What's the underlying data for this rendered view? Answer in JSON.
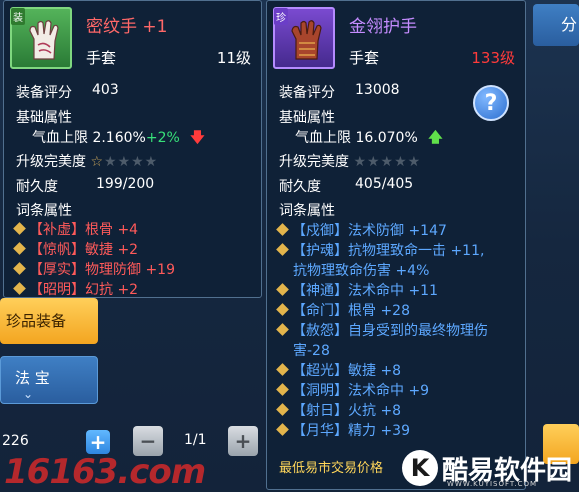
{
  "background": {
    "tab_top_right": "分",
    "tab_treasure": "珍品装备",
    "tab_fabao": "法 宝",
    "item_count": "226",
    "page": "1/1",
    "watermark_left": "16163.com",
    "watermark_right": "酷易软件园",
    "watermark_right_sub": "WWW.KUYISOFT.COM",
    "watermark_logo": "K"
  },
  "tooltip_left": {
    "corner_tag": "装",
    "name": "密纹手 +1",
    "type": "手套",
    "level": "11级",
    "score_label": "装备评分",
    "score": "403",
    "base_attr_label": "基础属性",
    "hp_label": "气血上限",
    "hp_value": "2.160%",
    "hp_diff": "+2%",
    "hp_trend": "down",
    "perfection_label": "升级完美度",
    "durability_label": "耐久度",
    "durability": "199/200",
    "affix_label": "词条属性",
    "affixes": [
      {
        "tag": "【补虚】",
        "text": "根骨 +4"
      },
      {
        "tag": "【惊帆】",
        "text": "敏捷 +2"
      },
      {
        "tag": "【厚实】",
        "text": "物理防御 +19"
      },
      {
        "tag": "【昭明】",
        "text": "幻抗 +2"
      }
    ]
  },
  "tooltip_right": {
    "corner_tag": "珍",
    "name": "金翎护手",
    "type": "手套",
    "level": "133级",
    "score_label": "装备评分",
    "score": "13008",
    "base_attr_label": "基础属性",
    "hp_label": "气血上限",
    "hp_value": "16.070%",
    "hp_trend": "up",
    "perfection_label": "升级完美度",
    "durability_label": "耐久度",
    "durability": "405/405",
    "affix_label": "词条属性",
    "affixes": [
      {
        "tag": "【戍御】",
        "text": "法术防御 +147"
      },
      {
        "tag": "【护魂】",
        "text": "抗物理致命一击 +11,"
      },
      {
        "tag": "",
        "text": "抗物理致命伤害 +4%"
      },
      {
        "tag": "【神通】",
        "text": "法术命中 +11"
      },
      {
        "tag": "【命门】",
        "text": "根骨 +28"
      },
      {
        "tag": "【赦怨】",
        "text": "自身受到的最终物理伤"
      },
      {
        "tag": "",
        "text": "害-28"
      },
      {
        "tag": "【超光】",
        "text": "敏捷 +8"
      },
      {
        "tag": "【洞明】",
        "text": "法术命中 +9"
      },
      {
        "tag": "【射日】",
        "text": "火抗 +8"
      },
      {
        "tag": "【月华】",
        "text": "精力 +39"
      }
    ],
    "price_label": "最低易市交易价格"
  },
  "colors": {
    "red_name": "#ff6868",
    "purple_name": "#c58cff",
    "affix_red": "#ff5a5a",
    "affix_blue": "#5da8ff",
    "accent_gold": "#f3a520"
  }
}
